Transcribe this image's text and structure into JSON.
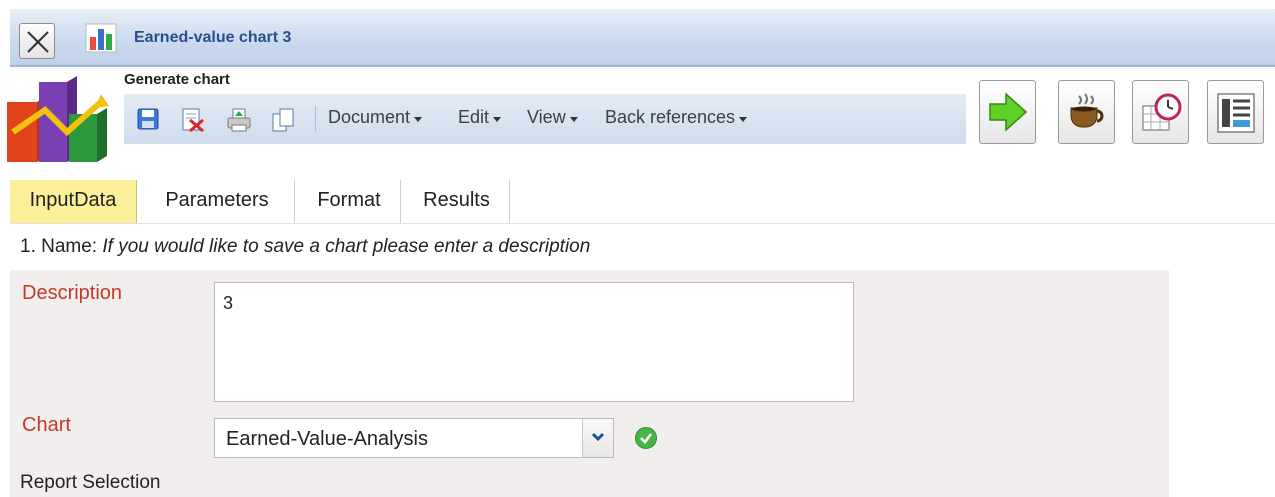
{
  "window": {
    "title": "Earned-value chart 3",
    "close_icon": "close-icon",
    "title_icon": "bar-chart-icon"
  },
  "header": {
    "title": "Generate chart",
    "logo_icon": "chart-logo-icon"
  },
  "toolbar": {
    "icons": [
      "save-icon",
      "delete-icon",
      "print-icon",
      "copy-icon"
    ],
    "menus": [
      {
        "label": "Document"
      },
      {
        "label": "Edit"
      },
      {
        "label": "View"
      },
      {
        "label": "Back references"
      }
    ]
  },
  "actions": [
    {
      "icon": "run-arrow-icon"
    },
    {
      "icon": "coffee-cup-icon"
    },
    {
      "icon": "schedule-clock-icon"
    },
    {
      "icon": "report-list-icon"
    }
  ],
  "tabs": [
    {
      "label": "InputData",
      "active": true
    },
    {
      "label": "Parameters",
      "active": false
    },
    {
      "label": "Format",
      "active": false
    },
    {
      "label": "Results",
      "active": false
    }
  ],
  "form": {
    "section_prefix": "1. Name:",
    "section_hint": "If you would like to save a chart please enter a description",
    "description_label": "Description",
    "description_value": "3",
    "chart_label": "Chart",
    "chart_value": "Earned-Value-Analysis",
    "chart_status_icon": "check-ok-icon",
    "report_selection_label": "Report Selection"
  },
  "colors": {
    "accent": "#2a4e8e",
    "label_red": "#c0392b",
    "active_tab": "#fbf09a",
    "panel_bg": "#f2eeee",
    "toolbar_bg": "#cfdcec"
  }
}
